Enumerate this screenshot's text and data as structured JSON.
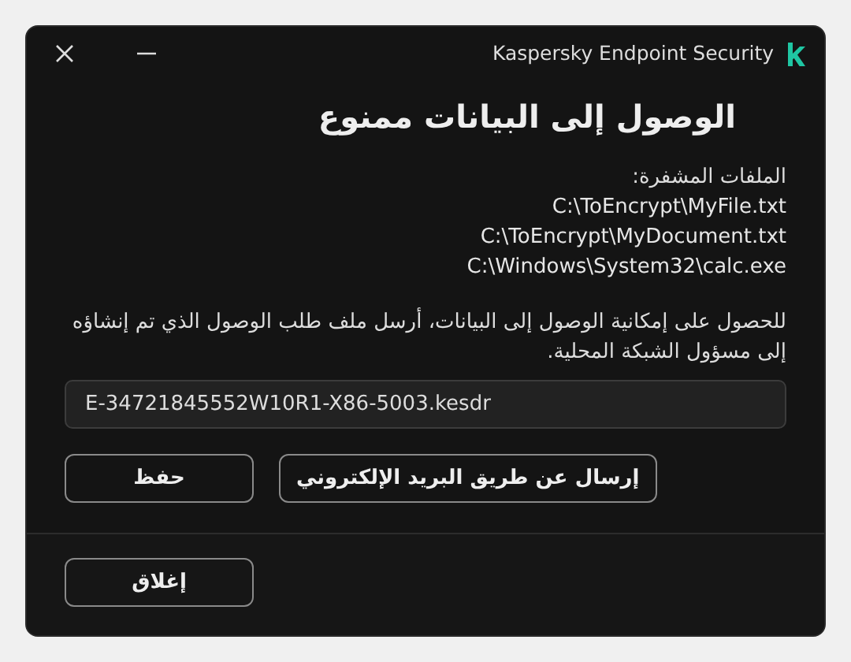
{
  "window": {
    "title": "Kaspersky Endpoint Security"
  },
  "heading": "الوصول إلى البيانات ممنوع",
  "files_label": "الملفات المشفرة:",
  "files": [
    "C:\\ToEncrypt\\MyFile.txt",
    "C:\\ToEncrypt\\MyDocument.txt",
    "C:\\Windows\\System32\\calc.exe"
  ],
  "instructions": "للحصول على إمكانية الوصول إلى البيانات، أرسل ملف طلب الوصول الذي تم إنشاؤه إلى مسؤول الشبكة المحلية.",
  "request_file": {
    "value": "E-34721845552W10R1-X86-5003.kesdr"
  },
  "actions": [
    {
      "label": "إرسال عن طريق البريد الإلكتروني"
    },
    {
      "label": "حفظ"
    }
  ],
  "footer_button": {
    "label": "إغلاق"
  }
}
